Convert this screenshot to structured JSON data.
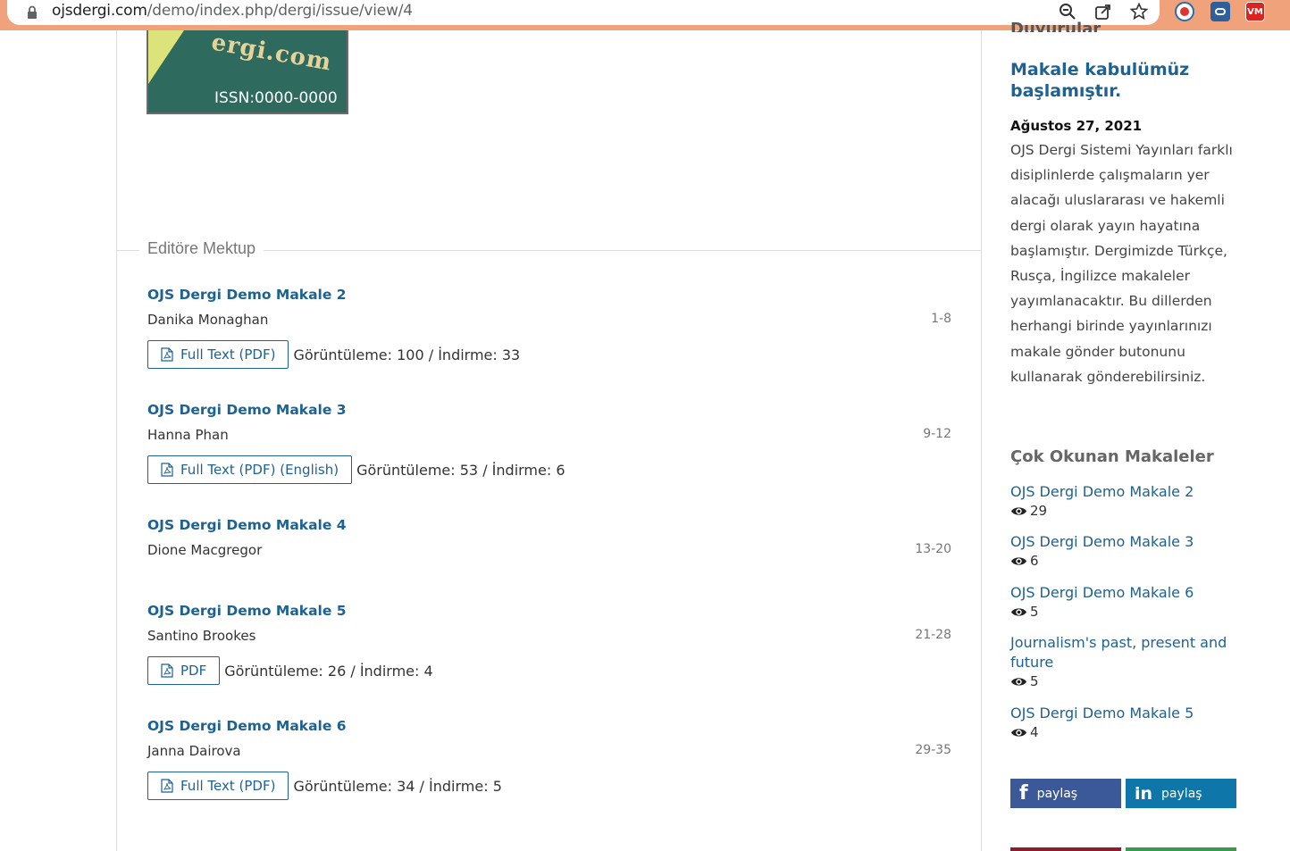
{
  "browser": {
    "url_host": "ojsdergi.com",
    "url_path": "/demo/index.php/dergi/issue/view/4",
    "ext_vm": "VM"
  },
  "cover": {
    "brand_text": "ergi.com",
    "issn": "ISSN:0000-0000"
  },
  "section": {
    "title": "Editöre Mektup"
  },
  "articles": [
    {
      "title": "OJS Dergi Demo Makale 2",
      "author": "Danika Monaghan",
      "pages": "1-8",
      "galley": "Full Text (PDF)",
      "stats": "Görüntüleme: 100 / İndirme: 33"
    },
    {
      "title": "OJS Dergi Demo Makale 3",
      "author": "Hanna Phan",
      "pages": "9-12",
      "galley": "Full Text (PDF) (English)",
      "stats": "Görüntüleme: 53 / İndirme: 6"
    },
    {
      "title": "OJS Dergi Demo Makale 4",
      "author": "Dione Macgregor",
      "pages": "13-20"
    },
    {
      "title": "OJS Dergi Demo Makale 5",
      "author": "Santino Brookes",
      "pages": "21-28",
      "galley": "PDF",
      "stats": "Görüntüleme: 26 / İndirme: 4"
    },
    {
      "title": "OJS Dergi Demo Makale 6",
      "author": "Janna Dairova",
      "pages": "29-35",
      "galley": "Full Text (PDF)",
      "stats": "Görüntüleme: 34 / İndirme: 5"
    }
  ],
  "sidebar": {
    "announcements_heading": "Duyurular",
    "announcement": {
      "title": "Makale kabulümüz başlamıştır.",
      "date": "Ağustos 27, 2021",
      "body": "OJS Dergi Sistemi Yayınları  farklı disiplinlerde çalışmaların yer alacağı uluslararası ve hakemli dergi olarak yayın hayatına başlamıştır. Dergimizde Türkçe, Rusça, İngilizce makaleler yayımlanacaktır. Bu dillerden herhangi birinde yayınlarınızı makale gönder butonunu kullanarak gönderebilirsiniz."
    },
    "popular_heading": "Çok Okunan Makaleler",
    "popular": [
      {
        "title": "OJS Dergi Demo Makale 2",
        "views": "29"
      },
      {
        "title": "OJS Dergi Demo Makale 3",
        "views": "6"
      },
      {
        "title": "OJS Dergi Demo Makale 6",
        "views": "5"
      },
      {
        "title": "Journalism's past, present and future",
        "views": "5"
      },
      {
        "title": "OJS Dergi Demo Makale 5",
        "views": "4"
      }
    ],
    "share_facebook": "paylaş",
    "share_linkedin": "paylaş"
  },
  "colors": {
    "link": "#1e6292",
    "facebook": "#3b5998",
    "linkedin": "#0e76a8",
    "browser_accent": "#f0a27a"
  }
}
